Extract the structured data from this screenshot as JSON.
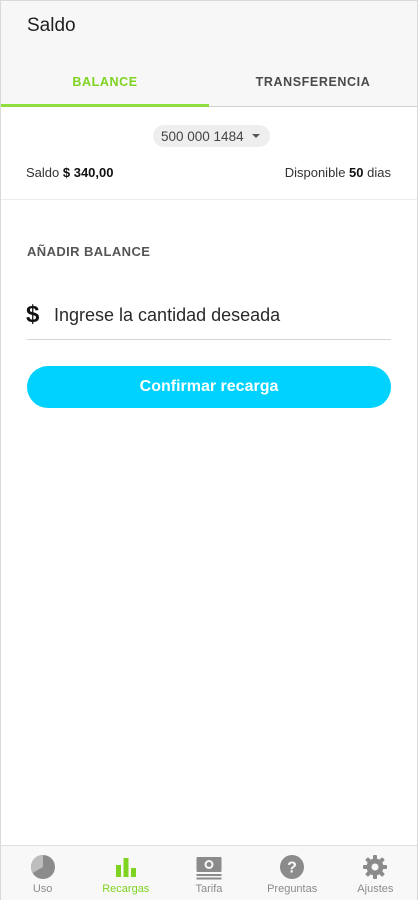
{
  "header": {
    "title": "Saldo"
  },
  "tabs": [
    {
      "label": "BALANCE",
      "active": true
    },
    {
      "label": "TRANSFERENCIA",
      "active": false
    }
  ],
  "account": {
    "number": "500 000 1484",
    "saldo_label": "Saldo",
    "saldo_value": "$ 340,00",
    "disponible_label": "Disponible",
    "disponible_days": "50",
    "disponible_unit": "dias"
  },
  "add_balance": {
    "section_label": "AÑADIR BALANCE",
    "currency_symbol": "$",
    "amount_placeholder": "Ingrese la cantidad deseada",
    "confirm_label": "Confirmar recarga"
  },
  "bottom_nav": [
    {
      "label": "Uso",
      "icon": "pie-chart-icon",
      "active": false
    },
    {
      "label": "Recargas",
      "icon": "bar-chart-icon",
      "active": true
    },
    {
      "label": "Tarifa",
      "icon": "money-bill-icon",
      "active": false
    },
    {
      "label": "Preguntas",
      "icon": "question-circle-icon",
      "active": false
    },
    {
      "label": "Ajustes",
      "icon": "gear-icon",
      "active": false
    }
  ],
  "colors": {
    "accent_green": "#7ed321",
    "button_cyan": "#00d2ff",
    "inactive_gray": "#8b8b8b"
  }
}
